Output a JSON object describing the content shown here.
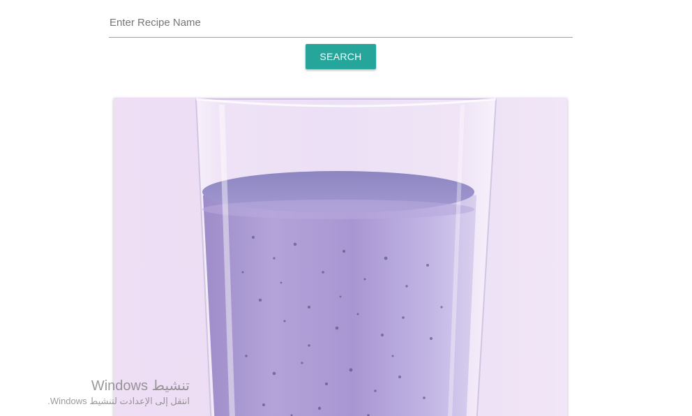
{
  "search": {
    "placeholder": "Enter Recipe Name",
    "value": ""
  },
  "search_button": {
    "label": "SEARCH"
  },
  "colors": {
    "accent": "#26a69a",
    "input_underline": "#9e9e9e"
  },
  "recipe_image": {
    "icon": "smoothie-glass-image"
  },
  "os_watermark": {
    "title": "تنشيط Windows",
    "subtitle": "انتقل إلى الإعدادت لتنشيط Windows."
  }
}
